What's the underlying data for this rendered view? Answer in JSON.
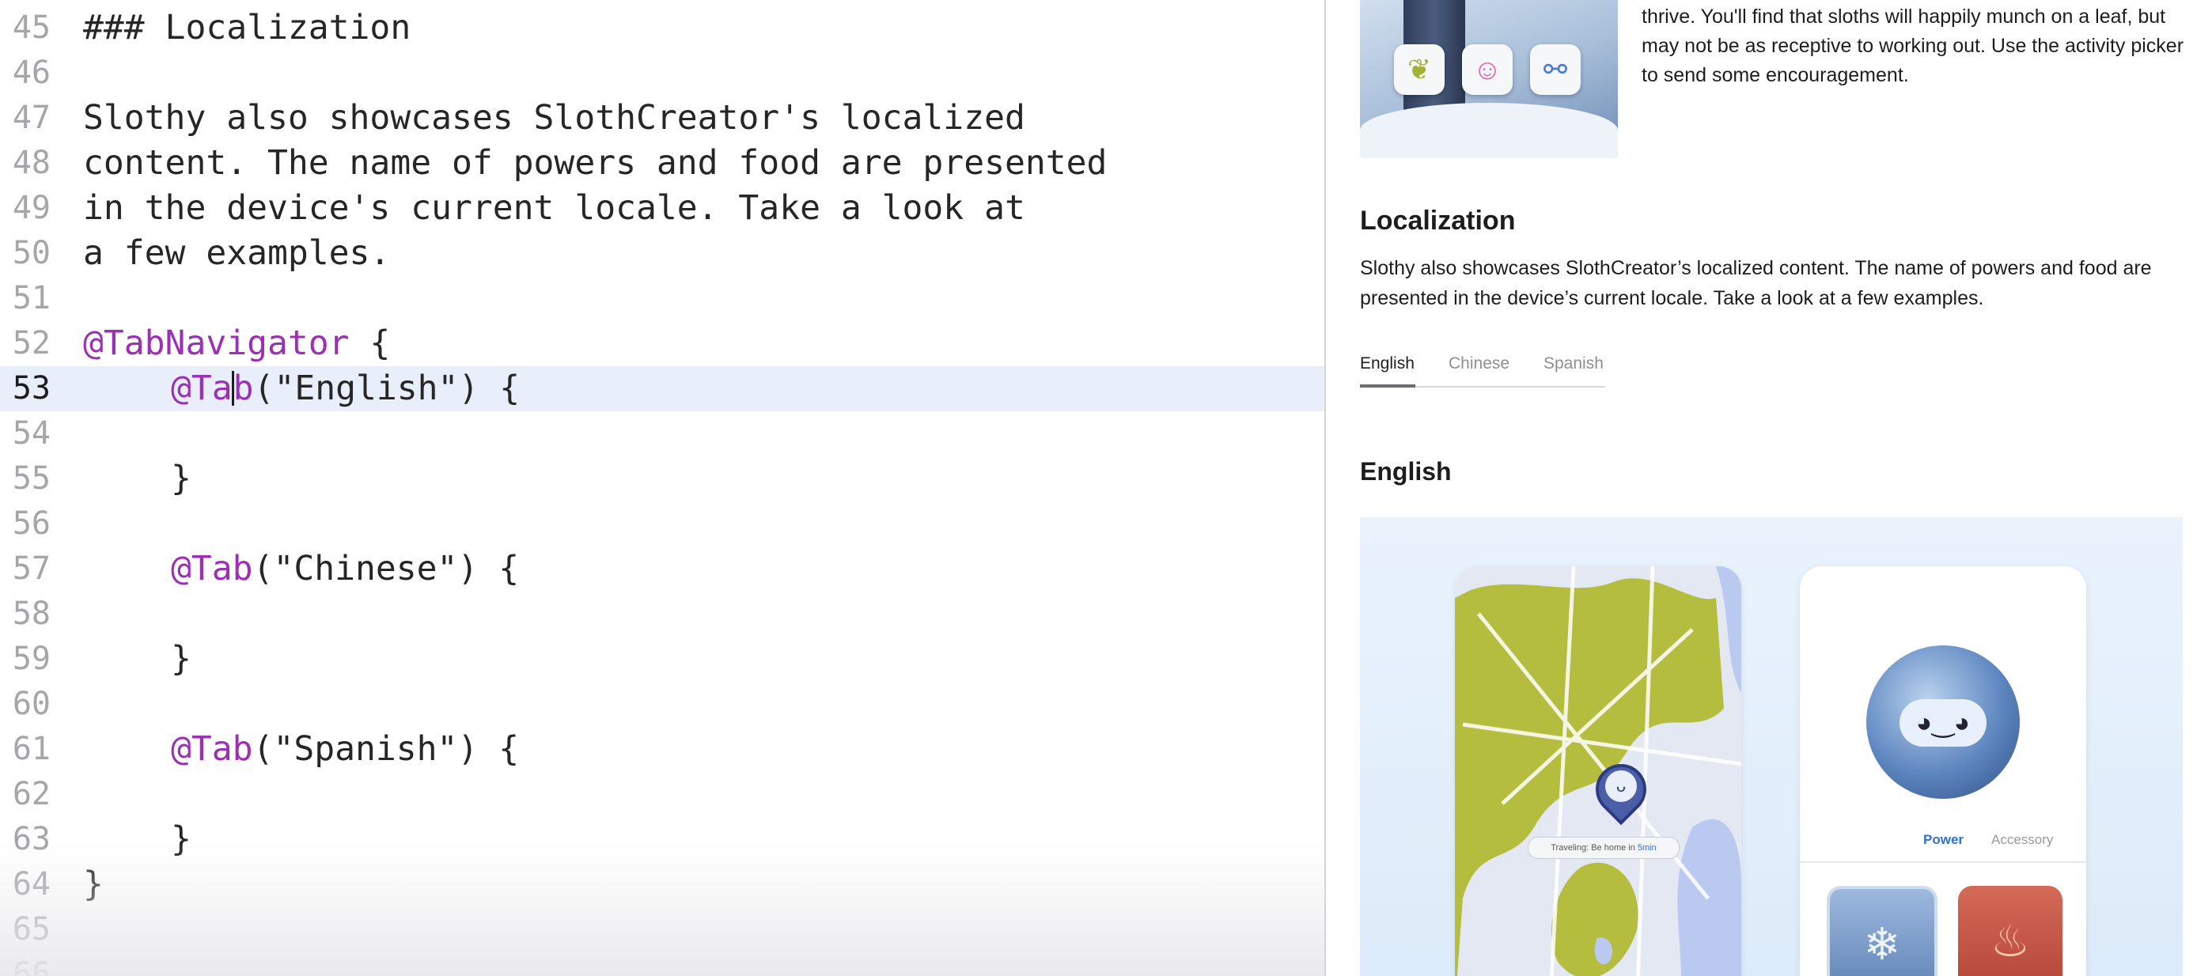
{
  "editor": {
    "lines": [
      {
        "n": "45",
        "parts": [
          {
            "t": "### Localization"
          }
        ]
      },
      {
        "n": "46",
        "parts": []
      },
      {
        "n": "47",
        "parts": [
          {
            "t": "Slothy also showcases SlothCreator's localized"
          }
        ]
      },
      {
        "n": "48",
        "parts": [
          {
            "t": "content. The name of powers and food are presented"
          }
        ]
      },
      {
        "n": "49",
        "parts": [
          {
            "t": "in the device's current locale. Take a look at"
          }
        ]
      },
      {
        "n": "50",
        "parts": [
          {
            "t": "a few examples."
          }
        ]
      },
      {
        "n": "51",
        "parts": []
      },
      {
        "n": "52",
        "parts": [
          {
            "t": "@TabNavigator",
            "kw": true
          },
          {
            "t": " {"
          }
        ]
      },
      {
        "n": "53",
        "current": true,
        "indent": 1,
        "parts": [
          {
            "t": "@Ta",
            "kw": true
          },
          {
            "caret": true
          },
          {
            "t": "b",
            "kw": true
          },
          {
            "t": "(\"English\") {"
          }
        ]
      },
      {
        "n": "54",
        "parts": []
      },
      {
        "n": "55",
        "indent": 1,
        "parts": [
          {
            "t": "}"
          }
        ]
      },
      {
        "n": "56",
        "parts": []
      },
      {
        "n": "57",
        "indent": 1,
        "parts": [
          {
            "t": "@Tab",
            "kw": true
          },
          {
            "t": "(\"Chinese\") {"
          }
        ]
      },
      {
        "n": "58",
        "parts": []
      },
      {
        "n": "59",
        "indent": 1,
        "parts": [
          {
            "t": "}"
          }
        ]
      },
      {
        "n": "60",
        "parts": []
      },
      {
        "n": "61",
        "indent": 1,
        "parts": [
          {
            "t": "@Tab",
            "kw": true
          },
          {
            "t": "(\"Spanish\") {"
          }
        ]
      },
      {
        "n": "62",
        "parts": []
      },
      {
        "n": "63",
        "indent": 1,
        "parts": [
          {
            "t": "}"
          }
        ]
      },
      {
        "n": "64",
        "parts": [
          {
            "t": "}"
          }
        ]
      },
      {
        "n": "65",
        "parts": []
      },
      {
        "n": "66",
        "parts": []
      }
    ]
  },
  "preview": {
    "intro_text": "Once you've customized your sloth, it's ready to ready to thrive. You'll find that sloths will happily munch on a leaf, but may not be as receptive to working out. Use the activity picker to send some encouragement.",
    "activity_icons": [
      {
        "name": "leaf-icon",
        "glyph": "❦",
        "color": "#a3b235"
      },
      {
        "name": "smiley-icon",
        "glyph": "☺",
        "color": "#e35fb2"
      },
      {
        "name": "dumbbell-icon",
        "glyph": "⚯",
        "color": "#4a79d8"
      }
    ],
    "heading": "Localization",
    "body": "Slothy also showcases SlothCreator’s localized content. The name of powers and food are presented in the device’s current locale. Take a look at a few examples.",
    "tabs": [
      "English",
      "Chinese",
      "Spanish"
    ],
    "active_tab": "English",
    "section_heading": "English",
    "map_pill": {
      "prefix": "Traveling: Be home in ",
      "highlight": "5min"
    },
    "segments": {
      "active": "Power",
      "inactive": "Accessory"
    }
  }
}
